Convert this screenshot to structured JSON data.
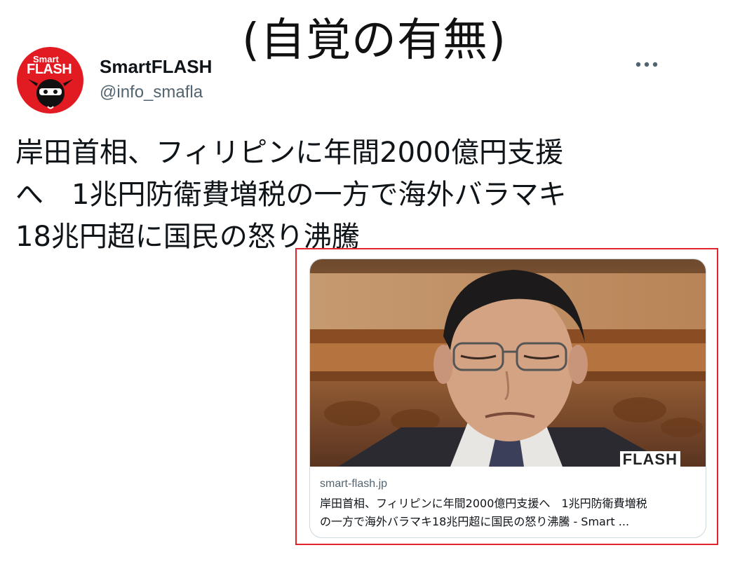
{
  "overlay": {
    "title": "(自覚の有無)"
  },
  "author": {
    "avatar_small_text": "Smart",
    "avatar_flash_text": "FLASH",
    "name": "SmartFLASH",
    "handle": "@info_smafla"
  },
  "tweet": {
    "text": "岸田首相、フィリピンに年間2000億円支援\nへ　1兆円防衛費増税の一方で海外バラマキ\n18兆円超に国民の怒り沸騰"
  },
  "card": {
    "domain": "smart-flash.jp",
    "title_line1": "岸田首相、フィリピンに年間2000億円支援へ　1兆円防衛費増税",
    "title_line2": "の一方で海外バラマキ18兆円超に国民の怒り沸騰 - Smart ...",
    "image_watermark": "FLASH"
  },
  "colors": {
    "highlight": "#e2242c",
    "brand_red": "#e21b23",
    "handle_gray": "#536471"
  },
  "icons": {
    "more": "more-horizontal-icon"
  }
}
